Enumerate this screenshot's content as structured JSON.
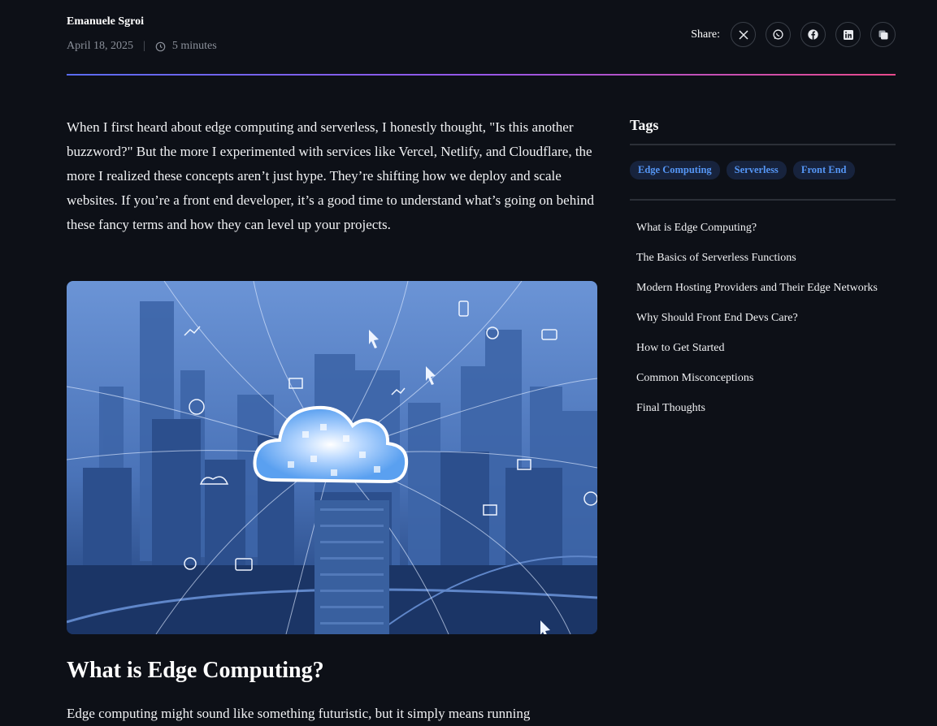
{
  "author": {
    "name": "Emanuele Sgroi",
    "date": "April 18, 2025",
    "separator": "|",
    "read_time": "5 minutes"
  },
  "share": {
    "label": "Share:",
    "buttons": [
      {
        "icon": "x-twitter-icon"
      },
      {
        "icon": "whatsapp-icon"
      },
      {
        "icon": "facebook-icon"
      },
      {
        "icon": "linkedin-icon"
      },
      {
        "icon": "copy-link-icon"
      }
    ]
  },
  "colors": {
    "background": "#0d1017",
    "accent_gradient": [
      "#5a6cf0",
      "#9656e8",
      "#e84a8c"
    ],
    "tag_bg": "#17233d",
    "tag_text": "#5596f5"
  },
  "article": {
    "intro": "When I first heard about edge computing and serverless, I honestly thought, \"Is this another buzzword?\" But the more I experimented with services like Vercel, Netlify, and Cloudflare, the more I realized these concepts aren’t just hype. They’re shifting how we deploy and scale websites. If you’re a front end developer, it’s a good time to understand what’s going on behind these fancy terms and how they can level up your projects.",
    "heading": "What is Edge Computing?",
    "paragraph": "Edge computing might sound like something futuristic, but it simply means running"
  },
  "sidebar": {
    "tags_title": "Tags",
    "tags": [
      "Edge Computing",
      "Serverless",
      "Front End"
    ],
    "toc": [
      "What is Edge Computing?",
      "The Basics of Serverless Functions",
      "Modern Hosting Providers and Their Edge Networks",
      "Why Should Front End Devs Care?",
      "How to Get Started",
      "Common Misconceptions",
      "Final Thoughts"
    ]
  }
}
